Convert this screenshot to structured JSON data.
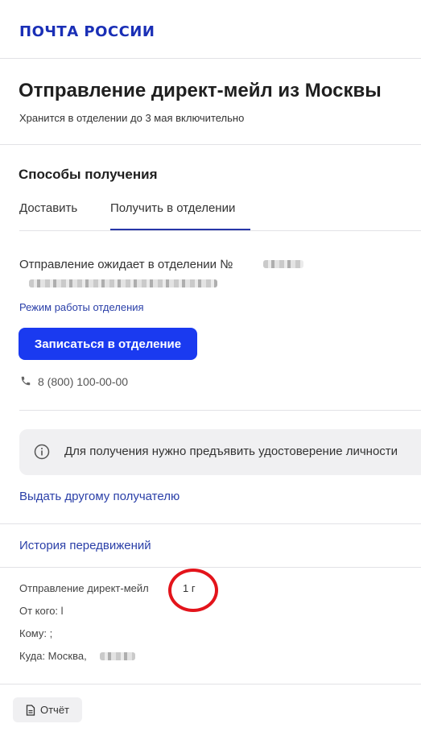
{
  "header": {
    "logo": "ПОЧТА РОССИИ"
  },
  "shipment": {
    "title": "Отправление директ-мейл из Москвы",
    "subtitle": "Хранится в отделении до 3 мая включительно"
  },
  "receive": {
    "section_title": "Способы получения",
    "tabs": [
      {
        "label": "Доставить"
      },
      {
        "label": "Получить в отделении"
      }
    ],
    "waiting_text": "Отправление ожидает в отделении №",
    "hours_link": "Режим работы отделения",
    "book_button": "Записаться в отделение",
    "phone": "8 (800) 100-00-00",
    "notice": "Для получения нужно предъявить удостоверение личности",
    "other_recipient_link": "Выдать другому получателю"
  },
  "history": {
    "link": "История передвижений"
  },
  "details": {
    "type_label": "Отправление директ-мейл",
    "weight": "1 г",
    "from": "От кого: l",
    "to": "Кому: ;",
    "where": "Куда: Москва,"
  },
  "footer": {
    "report_button": "Отчёт"
  },
  "colors": {
    "brand": "#1a2fb6",
    "primary_button": "#1a3af0",
    "link": "#2a3fa8",
    "annotation": "#e3141b"
  }
}
